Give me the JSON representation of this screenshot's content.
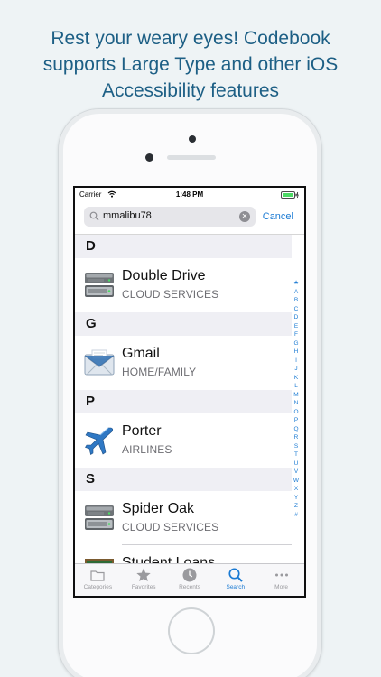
{
  "headline": {
    "line1": "Rest your weary eyes! Codebook",
    "line2": "supports Large Type and other iOS",
    "line3": "Accessibility features"
  },
  "status": {
    "carrier": "Carrier",
    "time": "1:48 PM"
  },
  "search": {
    "value": "mmalibu78",
    "cancel_label": "Cancel"
  },
  "sections": [
    {
      "letter": "D",
      "title": "Double Drive",
      "category": "CLOUD SERVICES",
      "icon": "drive-icon"
    },
    {
      "letter": "G",
      "title": "Gmail",
      "category": "HOME/FAMILY",
      "icon": "mail-icon"
    },
    {
      "letter": "P",
      "title": "Porter",
      "category": "AIRLINES",
      "icon": "airplane-icon"
    },
    {
      "letter": "S",
      "title": "Spider Oak",
      "category": "CLOUD SERVICES",
      "icon": "drive-icon",
      "next_title": "Student Loans"
    }
  ],
  "index_letters": [
    "★",
    "A",
    "B",
    "C",
    "D",
    "E",
    "F",
    "G",
    "H",
    "I",
    "J",
    "K",
    "L",
    "M",
    "N",
    "O",
    "P",
    "Q",
    "R",
    "S",
    "T",
    "U",
    "V",
    "W",
    "X",
    "Y",
    "Z",
    "#"
  ],
  "tabs": [
    {
      "label": "Categories",
      "icon": "folder-icon"
    },
    {
      "label": "Favorites",
      "icon": "star-icon"
    },
    {
      "label": "Recents",
      "icon": "clock-icon"
    },
    {
      "label": "Search",
      "icon": "search-icon",
      "active": true
    },
    {
      "label": "More",
      "icon": "ellipsis-icon"
    }
  ],
  "colors": {
    "accent": "#1a7ad3",
    "headline": "#1d5f85",
    "background": "#eef3f5"
  }
}
